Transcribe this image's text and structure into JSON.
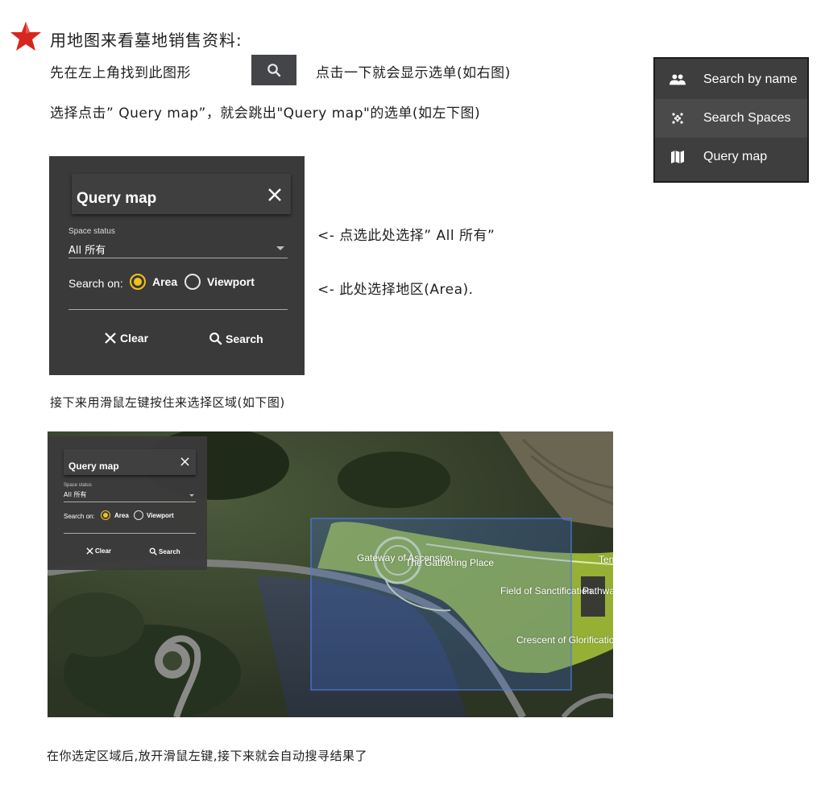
{
  "header": {
    "title": "用地图来看墓地销售资料:",
    "star_color": "#d7261e"
  },
  "instructions": {
    "line1_a": "先在左上角找到此图形",
    "line1_b": "点击一下就会显示选单(如右图)",
    "line2": "选择点击” Query map”，就会跳出\"Query map\"的选单(如左下图)",
    "note_status": "<- 点选此处选择” All 所有”",
    "note_area": "<- 此处选择地区(Area).",
    "line3": "接下来用滑鼠左键按住来选择区域(如下图)",
    "footer": "在你选定区域后,放开滑鼠左键,接下来就会自动搜寻结果了"
  },
  "search_button": {
    "icon": "search-icon"
  },
  "menu": {
    "items": [
      {
        "label": "Search by name",
        "icon": "people-icon"
      },
      {
        "label": "Search Spaces",
        "icon": "grid-dots-icon"
      },
      {
        "label": "Query map",
        "icon": "map-icon"
      }
    ]
  },
  "query_panel": {
    "title": "Query map",
    "status_label": "Space status",
    "status_value": "All 所有",
    "search_on_label": "Search on:",
    "option_area": "Area",
    "option_viewport": "Viewport",
    "selected_option": "Area",
    "clear_label": "Clear",
    "search_label": "Search",
    "accent_color": "#f2c21b"
  },
  "map": {
    "labels": [
      "Gateway of Ascension",
      "The Gathering Place",
      "Field of Sanctification",
      "Pathway o",
      "Crescent of Glorificatio",
      "Ten"
    ],
    "selection_color": "#3d6fd6",
    "plot_color": "#b5d33a"
  }
}
